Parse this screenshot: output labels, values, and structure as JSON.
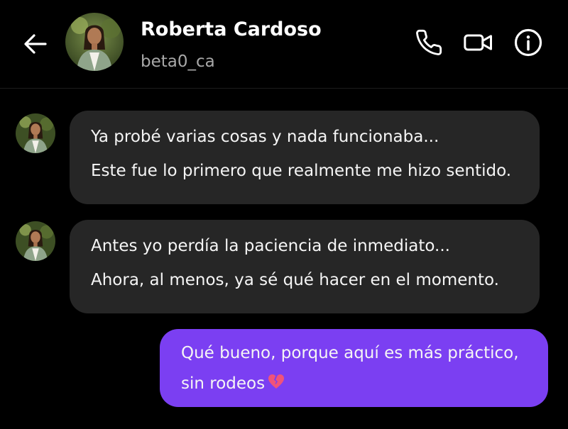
{
  "header": {
    "contact_name": "Roberta Cardoso",
    "contact_handle": "beta0_ca",
    "icons": [
      "back-arrow-icon",
      "phone-icon",
      "video-camera-icon",
      "info-icon"
    ]
  },
  "messages": [
    {
      "direction": "incoming",
      "lines": [
        "Ya probé varias cosas y nada funcionaba...",
        "Este fue lo primero que realmente me hizo sentido."
      ]
    },
    {
      "direction": "incoming",
      "lines": [
        "Antes yo perdía la paciencia de inmediato...",
        "Ahora, al menos, ya sé qué hacer en el momento."
      ]
    },
    {
      "direction": "outgoing",
      "lines": [
        "Qué bueno, porque aquí es más práctico,",
        "sin rodeos"
      ],
      "emoji": "broken-heart-emoji"
    }
  ],
  "colors": {
    "background": "#000000",
    "incoming_bubble": "#262626",
    "outgoing_bubble": "#7b3ff2",
    "secondary_text": "#a8a8a8"
  }
}
